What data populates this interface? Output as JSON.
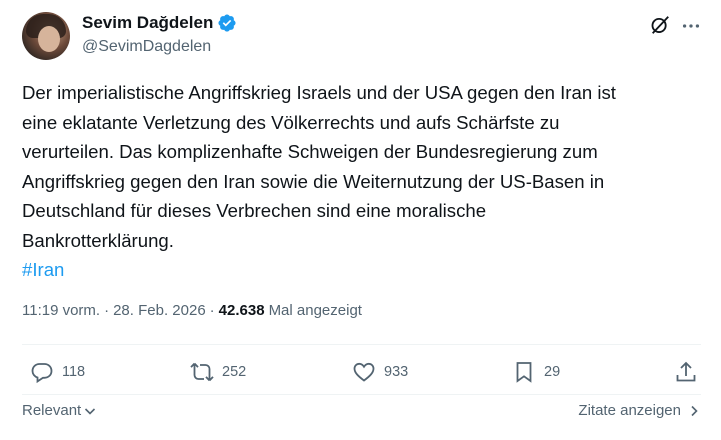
{
  "author": {
    "name": "Sevim Dağdelen",
    "handle": "@SevimDagdelen",
    "verified_icon": "verified-badge-icon"
  },
  "tweet": {
    "lines": [
      "Der imperialistische Angriffskrieg Israels und der USA gegen den Iran ist",
      "eine eklatante Verletzung des Völkerrechts und aufs Schärfste zu",
      "verurteilen. Das komplizenhafte Schweigen der Bundesregierung zum",
      "Angriffskrieg gegen den Iran sowie die Weiternutzung der US-Basen in",
      "Deutschland für dieses Verbrechen sind eine moralische",
      "Bankrotterklärung."
    ],
    "hashtag": "#Iran"
  },
  "meta": {
    "time": "11:19 vorm.",
    "separator": "·",
    "date": "28. Feb. 2026",
    "views": "42.638",
    "views_label": "Mal angezeigt"
  },
  "actions": {
    "replies": "118",
    "reposts": "252",
    "likes": "933",
    "bookmarks": "29"
  },
  "footer": {
    "relevant_label": "Relevant",
    "quotes_label": "Zitate anzeigen"
  },
  "colors": {
    "accent": "#1d9bf0",
    "secondary_text": "#536471",
    "primary_text": "#0f1419"
  }
}
